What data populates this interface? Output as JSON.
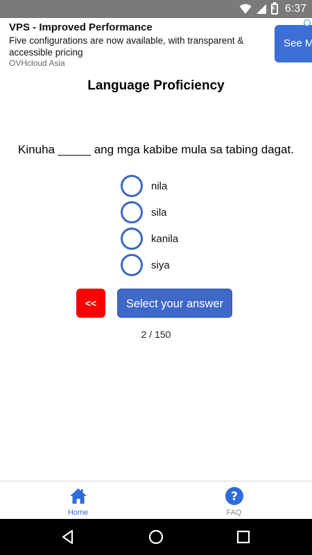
{
  "status_bar": {
    "time": "6:37"
  },
  "ad": {
    "title": "VPS - Improved Performance",
    "description": "Five configurations are now available, with transparent & accessible pricing",
    "source": "OVHcloud Asia",
    "cta_label": "See M"
  },
  "page": {
    "title": "Language Proficiency",
    "question": "Kinuha _____ ang mga kabibe mula sa tabing dagat.",
    "options": [
      "nila",
      "sila",
      "kanila",
      "siya"
    ],
    "back_label": "<<",
    "submit_label": "Select your answer",
    "progress": "2 / 150"
  },
  "bottom_nav": {
    "items": [
      {
        "label": "Home",
        "icon": "home-icon",
        "active": true
      },
      {
        "label": "FAQ",
        "icon": "help-circle-icon",
        "active": false
      }
    ]
  },
  "colors": {
    "accent": "#3f68c8",
    "back_button": "#ff0000",
    "status_bar": "#7a7a7a",
    "nav_active": "#2f6bdb"
  }
}
